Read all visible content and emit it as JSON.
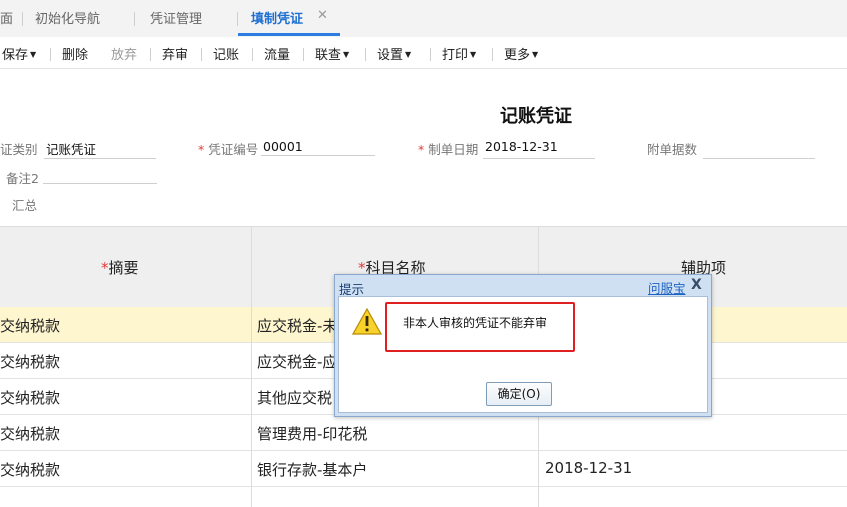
{
  "tabs": [
    {
      "label": "面"
    },
    {
      "label": "初始化导航"
    },
    {
      "label": "凭证管理"
    },
    {
      "label": "填制凭证",
      "close": "✕"
    }
  ],
  "toolbar": {
    "save": "保存",
    "delete": "删除",
    "discard": "放弃",
    "abandon_review": "弃审",
    "post": "记账",
    "flow": "流量",
    "link_query": "联查",
    "settings": "设置",
    "print": "打印",
    "more": "更多"
  },
  "voucher": {
    "title": "记账凭证",
    "type_label": "证类别",
    "type_value": "记账凭证",
    "number_label": "凭证编号",
    "number_value": "00001",
    "date_label": "制单日期",
    "date_value": "2018-12-31",
    "attach_label": "附单据数",
    "note_label": "备注2",
    "summary_label": "汇总",
    "required_mark": "*"
  },
  "table": {
    "columns": [
      "摘要",
      "科目名称",
      "辅助项"
    ],
    "rows": [
      {
        "summary": "交纳税款",
        "account": "应交税金-未",
        "aux": ""
      },
      {
        "summary": "交纳税款",
        "account": "应交税金-应",
        "aux": ""
      },
      {
        "summary": "交纳税款",
        "account": "其他应交税",
        "aux": ""
      },
      {
        "summary": "交纳税款",
        "account": "管理费用-印花税",
        "aux": ""
      },
      {
        "summary": "交纳税款",
        "account": "银行存款-基本户",
        "aux": "2018-12-31"
      }
    ]
  },
  "dialog": {
    "title": "提示",
    "help": "问服宝",
    "close": "X",
    "message": "非本人审核的凭证不能弃审",
    "ok": "确定(O)",
    "icon": "warning-icon"
  },
  "colors": {
    "accent": "#2d7ce0",
    "selected_row": "#fdf6cf",
    "highlight_border": "#e02020"
  }
}
